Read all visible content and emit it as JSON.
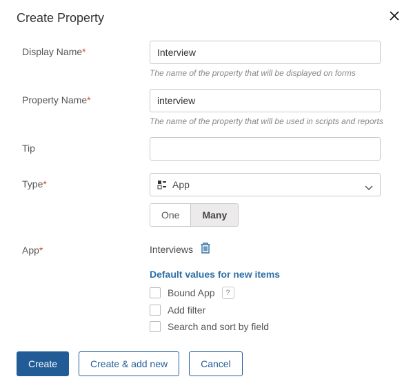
{
  "modal": {
    "title": "Create Property"
  },
  "fields": {
    "displayName": {
      "label": "Display Name",
      "value": "Interview",
      "help": "The name of the property that will be displayed on forms"
    },
    "propertyName": {
      "label": "Property Name",
      "value": "interview",
      "help": "The name of the property that will be used in scripts and reports"
    },
    "tip": {
      "label": "Tip",
      "value": ""
    },
    "type": {
      "label": "Type",
      "value": "App",
      "cardinality": {
        "one": "One",
        "many": "Many",
        "selected": "many"
      }
    },
    "app": {
      "label": "App",
      "value": "Interviews",
      "defaultsTitle": "Default values for new items",
      "checks": {
        "bound": "Bound App",
        "addFilter": "Add filter",
        "searchSort": "Search and sort by field"
      }
    }
  },
  "footer": {
    "create": "Create",
    "createAdd": "Create & add new",
    "cancel": "Cancel"
  },
  "asterisk": "*",
  "helpGlyph": "?"
}
